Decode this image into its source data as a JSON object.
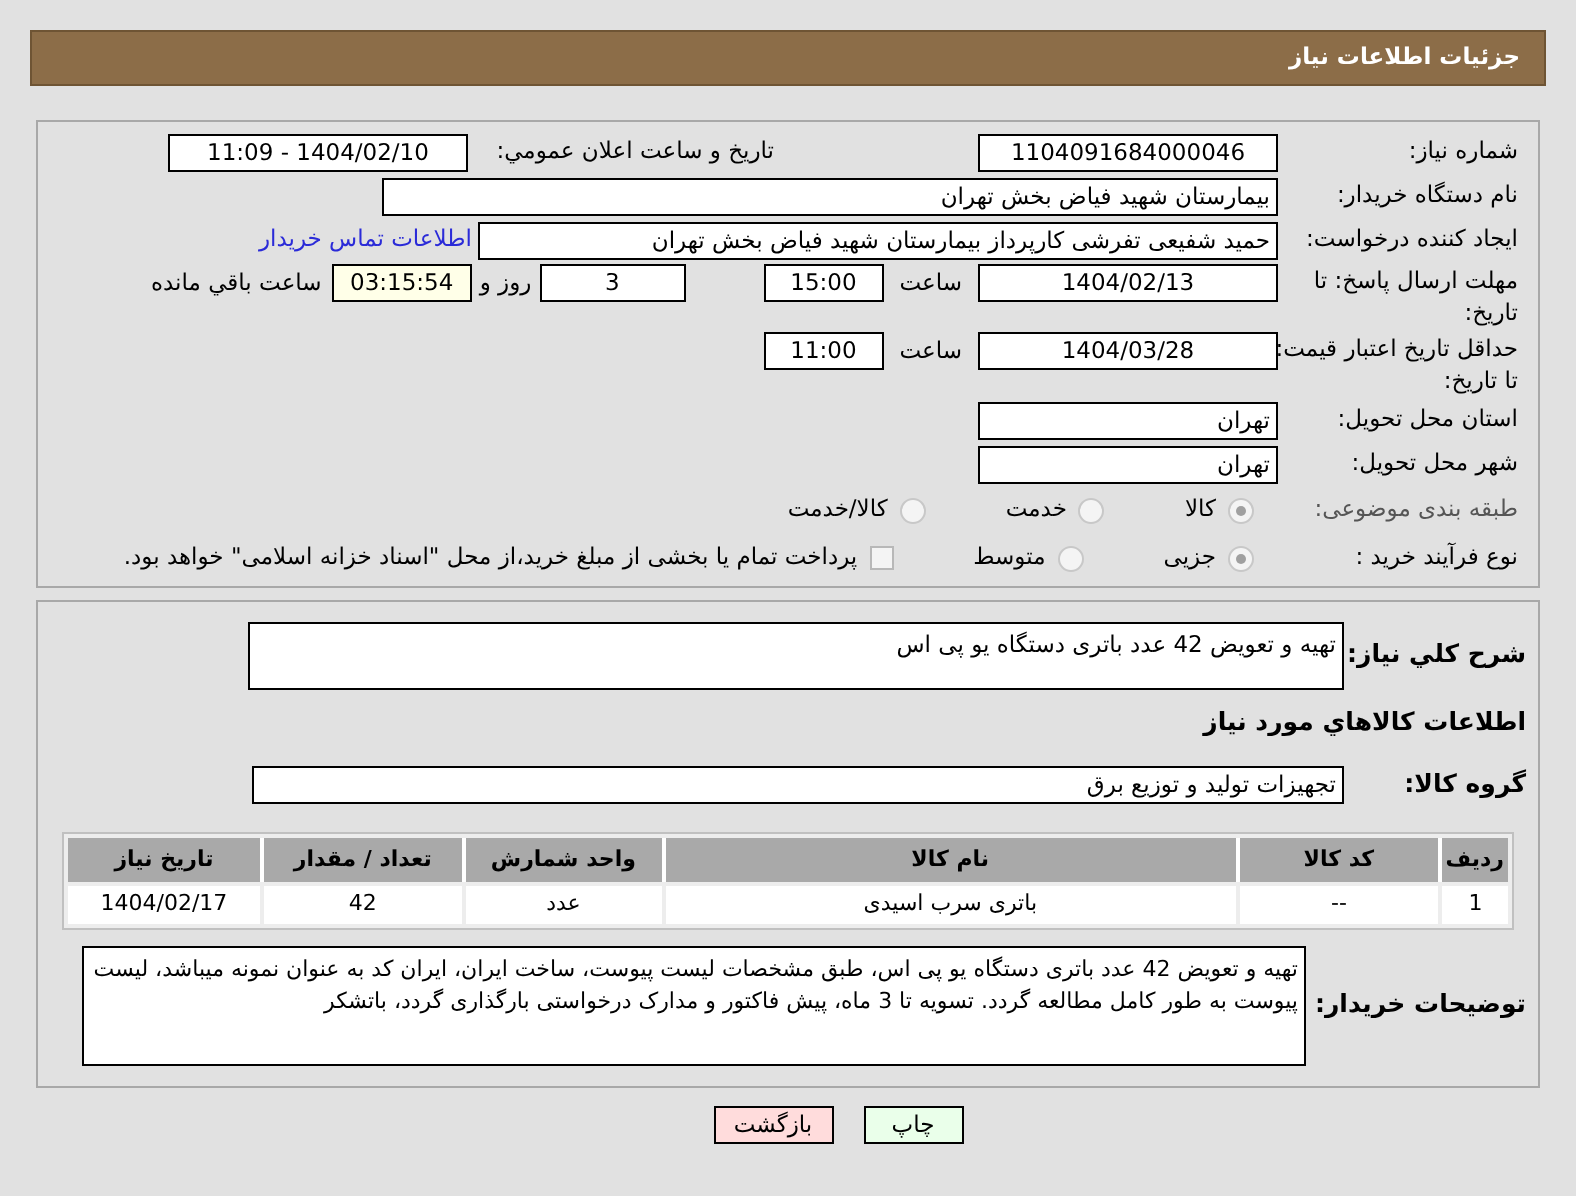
{
  "header": {
    "title": "جزئیات اطلاعات نیاز"
  },
  "need_number": {
    "label": "شماره نیاز:",
    "value": "1104091684000046"
  },
  "announce": {
    "label": "تاریخ و ساعت اعلان عمومي:",
    "value": "1404/02/10 - 11:09"
  },
  "buyer_org": {
    "label": "نام دستگاه خريدار:",
    "value": "بیمارستان شهید فیاض بخش تهران"
  },
  "creator": {
    "label": "ایجاد کننده درخواست:",
    "value": "حمید شفیعی تفرشی کارپرداز بیمارستان شهید فیاض بخش تهران",
    "link": "اطلاعات تماس خریدار"
  },
  "reply_deadline": {
    "label": "مهلت ارسال پاسخ: تا تاریخ:",
    "date": "1404/02/13",
    "time_label": "ساعت",
    "time": "15:00",
    "days": "3",
    "days_label": "روز و",
    "remaining": "03:15:54",
    "remaining_label": "ساعت باقي مانده"
  },
  "price_validity": {
    "label": "حداقل تاریخ اعتبار قیمت: تا تاریخ:",
    "date": "1404/03/28",
    "time_label": "ساعت",
    "time": "11:00"
  },
  "province": {
    "label": "استان محل تحویل:",
    "value": "تهران"
  },
  "city": {
    "label": "شهر محل تحویل:",
    "value": "تهران"
  },
  "category": {
    "label": "طبقه بندی موضوعی:",
    "options": [
      {
        "label": "کالا",
        "selected": true
      },
      {
        "label": "خدمت",
        "selected": false
      },
      {
        "label": "کالا/خدمت",
        "selected": false
      }
    ]
  },
  "process": {
    "label": "نوع فرآیند خرید :",
    "options": [
      {
        "label": "جزیی",
        "selected": true
      },
      {
        "label": "متوسط",
        "selected": false
      }
    ],
    "payment": {
      "checked": false,
      "text": "پرداخت تمام یا بخشی از مبلغ خرید،از محل \"اسناد خزانه اسلامی\" خواهد بود."
    }
  },
  "description": {
    "label": "شرح کلي نياز:",
    "value": "تهیه و تعویض 42 عدد باتری دستگاه یو پی اس"
  },
  "goods_heading": "اطلاعات کالاهاي مورد نياز",
  "goods_group": {
    "label": "گروه کالا:",
    "value": "تجهیزات تولید و توزیع برق"
  },
  "table": {
    "columns": [
      "ردیف",
      "کد کالا",
      "نام کالا",
      "واحد شمارش",
      "تعداد / مقدار",
      "تاریخ نیاز"
    ],
    "rows": [
      [
        "1",
        "--",
        "باتری سرب اسیدی",
        "عدد",
        "42",
        "1404/02/17"
      ]
    ]
  },
  "buyer_notes": {
    "label": "توضیحات خریدار:",
    "value": "تهیه و تعویض 42 عدد باتری دستگاه یو پی اس، طبق مشخصات لیست پیوست، ساخت ایران، ایران کد به عنوان نمونه میباشد، لیست پیوست به طور کامل مطالعه گردد. تسویه تا 3 ماه، پیش فاکتور و مدارک درخواستی بارگذاری گردد، باتشکر"
  },
  "buttons": [
    {
      "label": "چاپ",
      "kind": "print"
    },
    {
      "label": "بازگشت",
      "kind": "back"
    }
  ]
}
